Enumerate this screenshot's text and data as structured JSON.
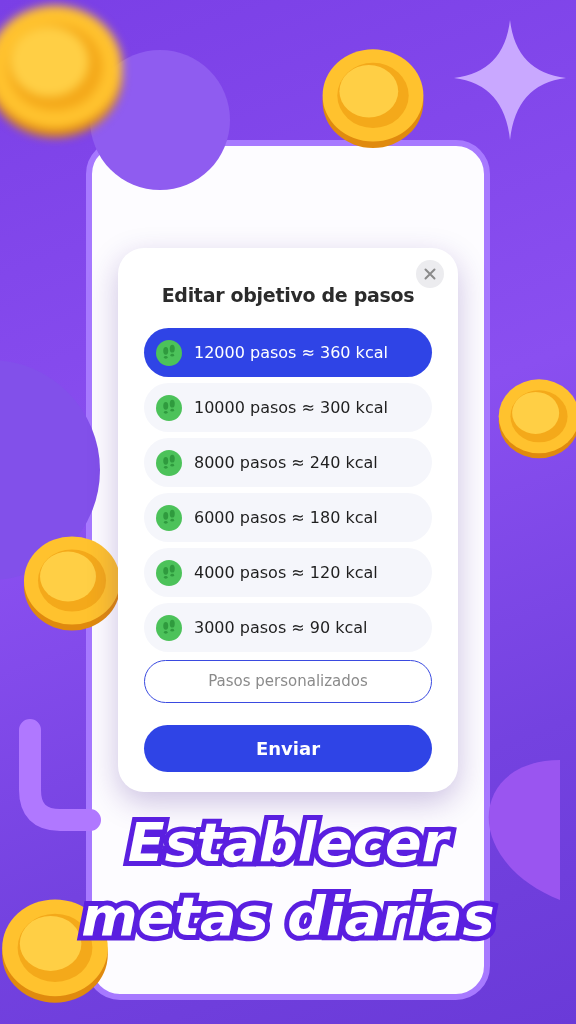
{
  "dialog": {
    "title": "Editar objetivo de pasos",
    "options": [
      {
        "label": "12000 pasos ≈ 360 kcal",
        "selected": true
      },
      {
        "label": "10000 pasos ≈ 300 kcal",
        "selected": false
      },
      {
        "label": "8000 pasos ≈ 240 kcal",
        "selected": false
      },
      {
        "label": "6000 pasos ≈ 180 kcal",
        "selected": false
      },
      {
        "label": "4000 pasos ≈ 120 kcal",
        "selected": false
      },
      {
        "label": "3000 pasos ≈ 90 kcal",
        "selected": false
      }
    ],
    "custom_field": {
      "placeholder": "Pasos personalizados"
    },
    "submit_button": "Enviar"
  },
  "headline": [
    "Establecer",
    "metas diarias"
  ]
}
